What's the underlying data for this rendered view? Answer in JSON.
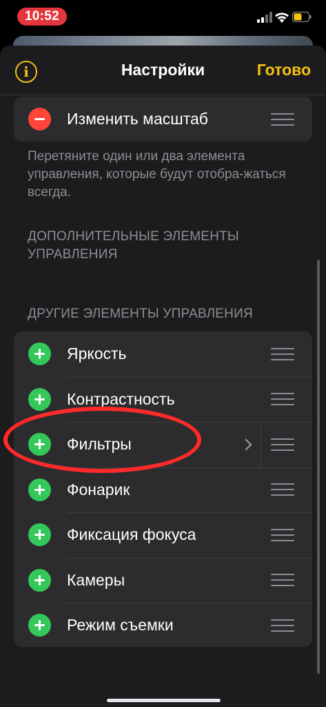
{
  "status_bar": {
    "time": "10:52",
    "time_pill_color": "#e5353c"
  },
  "nav": {
    "title": "Настройки",
    "done_label": "Готово",
    "info_icon": "info-icon"
  },
  "colors": {
    "accent": "#f5c211",
    "add": "#34c759",
    "remove": "#ff453a",
    "annotation": "#ff2a2a"
  },
  "included": {
    "items": [
      {
        "label": "Изменить масштаб",
        "action": "remove"
      }
    ]
  },
  "footer_text": "Перетяните один или два элемента управления, которые будут отобра-жаться всегда.",
  "additional_header": "ДОПОЛНИТЕЛЬНЫЕ ЭЛЕМЕНТЫ УПРАВЛЕНИЯ",
  "other_header": "ДРУГИЕ ЭЛЕМЕНТЫ УПРАВЛЕНИЯ",
  "other": {
    "items": [
      {
        "label": "Яркость"
      },
      {
        "label": "Контрастность"
      },
      {
        "label": "Фильтры",
        "has_chevron": true,
        "annotated": true
      },
      {
        "label": "Фонарик"
      },
      {
        "label": "Фиксация фокуса"
      },
      {
        "label": "Камеры"
      },
      {
        "label": "Режим съемки"
      }
    ]
  }
}
